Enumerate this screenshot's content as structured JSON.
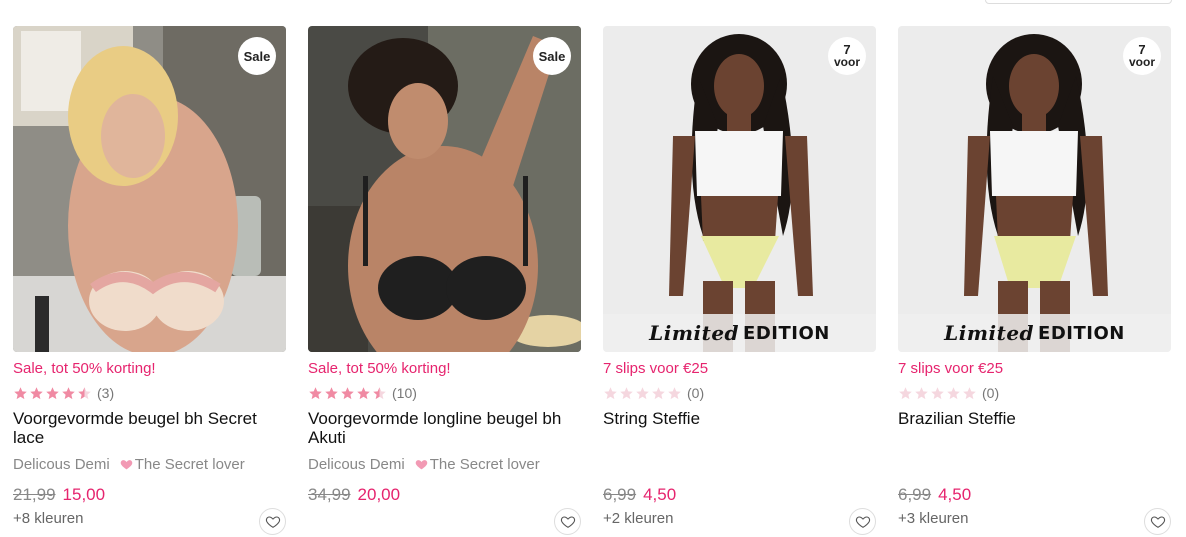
{
  "products": [
    {
      "badge": "Sale",
      "promo": "Sale, tot 50% korting!",
      "rating_filled": 4.5,
      "rating_count": "(3)",
      "title": "Voorgevormde beugel bh Secret lace",
      "collection_a": "Delicous Demi",
      "collection_b": "The Secret lover",
      "price_old": "21,99",
      "price_new": "15,00",
      "colors": "+8 kleuren"
    },
    {
      "badge": "Sale",
      "promo": "Sale, tot 50% korting!",
      "rating_filled": 4.5,
      "rating_count": "(10)",
      "title": "Voorgevormde longline beugel bh Akuti",
      "collection_a": "Delicous Demi",
      "collection_b": "The Secret lover",
      "price_old": "34,99",
      "price_new": "20,00",
      "colors": ""
    },
    {
      "badge_num": "7",
      "badge_word": "voor",
      "limited_script": "Limited",
      "limited_caps": "EDITION",
      "promo": "7 slips voor €25",
      "rating_filled": 0,
      "rating_count": "(0)",
      "title": "String Steffie",
      "price_old": "6,99",
      "price_new": "4,50",
      "colors": "+2 kleuren"
    },
    {
      "badge_num": "7",
      "badge_word": "voor",
      "limited_script": "Limited",
      "limited_caps": "EDITION",
      "promo": "7 slips voor €25",
      "rating_filled": 0,
      "rating_count": "(0)",
      "title": "Brazilian Steffie",
      "price_old": "6,99",
      "price_new": "4,50",
      "colors": "+3 kleuren"
    }
  ],
  "colors": {
    "accent": "#e6246e",
    "star_filled": "#f08aa3",
    "star_empty": "#f5d7df",
    "heart_mini": "#f29ab4"
  },
  "icons": {
    "wishlist": "heart-outline-icon",
    "collection": "heart-filled-icon",
    "rating": "star-icon"
  }
}
